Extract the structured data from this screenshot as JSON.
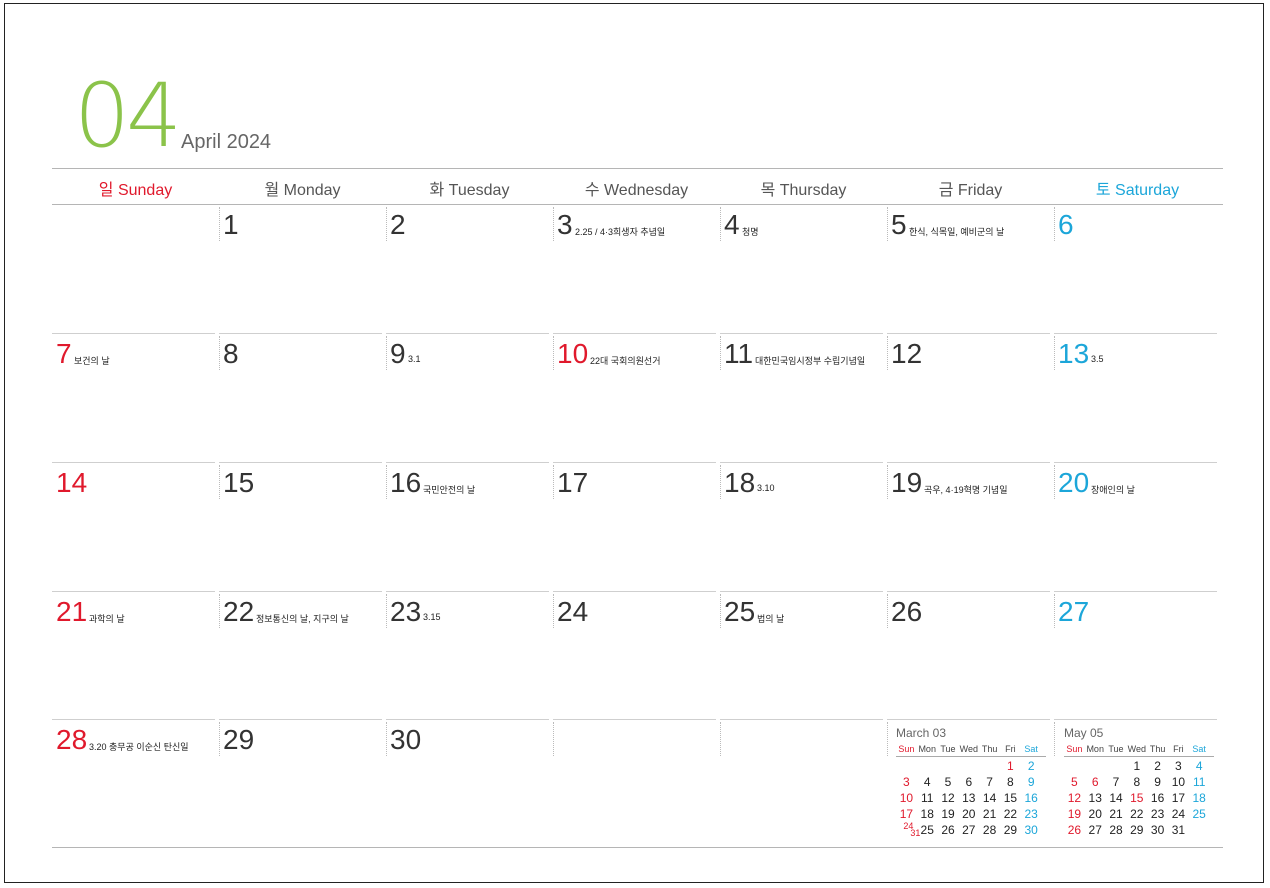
{
  "header": {
    "month_number": "04",
    "month_label": "April 2024"
  },
  "weekdays": [
    {
      "kr": "일",
      "en": "Sunday",
      "type": "sun"
    },
    {
      "kr": "월",
      "en": "Monday",
      "type": ""
    },
    {
      "kr": "화",
      "en": "Tuesday",
      "type": ""
    },
    {
      "kr": "수",
      "en": "Wednesday",
      "type": ""
    },
    {
      "kr": "목",
      "en": "Thursday",
      "type": ""
    },
    {
      "kr": "금",
      "en": "Friday",
      "type": ""
    },
    {
      "kr": "토",
      "en": "Saturday",
      "type": "sat"
    }
  ],
  "weeks": [
    [
      {
        "d": "",
        "n": ""
      },
      {
        "d": "1",
        "n": ""
      },
      {
        "d": "2",
        "n": ""
      },
      {
        "d": "3",
        "n": "2.25 / 4·3희생자 추념일"
      },
      {
        "d": "4",
        "n": "청명"
      },
      {
        "d": "5",
        "n": "한식, 식목일, 예비군의 날"
      },
      {
        "d": "6",
        "n": ""
      }
    ],
    [
      {
        "d": "7",
        "n": "보건의 날"
      },
      {
        "d": "8",
        "n": ""
      },
      {
        "d": "9",
        "n": "3.1"
      },
      {
        "d": "10",
        "n": "22대 국회의원선거",
        "red": true
      },
      {
        "d": "11",
        "n": "대한민국임시정부 수립기념일"
      },
      {
        "d": "12",
        "n": ""
      },
      {
        "d": "13",
        "n": "3.5"
      }
    ],
    [
      {
        "d": "14",
        "n": ""
      },
      {
        "d": "15",
        "n": ""
      },
      {
        "d": "16",
        "n": "국민안전의 날"
      },
      {
        "d": "17",
        "n": ""
      },
      {
        "d": "18",
        "n": "3.10"
      },
      {
        "d": "19",
        "n": "곡우, 4·19혁명 기념일"
      },
      {
        "d": "20",
        "n": "장애인의 날"
      }
    ],
    [
      {
        "d": "21",
        "n": "과학의 날"
      },
      {
        "d": "22",
        "n": "정보통신의 날, 지구의 날"
      },
      {
        "d": "23",
        "n": "3.15"
      },
      {
        "d": "24",
        "n": ""
      },
      {
        "d": "25",
        "n": "법의 날"
      },
      {
        "d": "26",
        "n": ""
      },
      {
        "d": "27",
        "n": ""
      }
    ],
    [
      {
        "d": "28",
        "n": "3.20 충무공 이순신 탄신일"
      },
      {
        "d": "29",
        "n": ""
      },
      {
        "d": "30",
        "n": ""
      },
      {
        "d": "",
        "n": ""
      },
      {
        "d": "",
        "n": ""
      },
      {
        "d": "",
        "n": ""
      },
      {
        "d": "",
        "n": ""
      }
    ]
  ],
  "mini_calendars": [
    {
      "title": "March 03",
      "days_header": [
        "Sun",
        "Mon",
        "Tue",
        "Wed",
        "Thu",
        "Fri",
        "Sat"
      ],
      "rows": [
        [
          "",
          "",
          "",
          "",
          "",
          "1",
          "2"
        ],
        [
          "3",
          "4",
          "5",
          "6",
          "7",
          "8",
          "9"
        ],
        [
          "10",
          "11",
          "12",
          "13",
          "14",
          "15",
          "16"
        ],
        [
          "17",
          "18",
          "19",
          "20",
          "21",
          "22",
          "23"
        ],
        [
          "24/31",
          "25",
          "26",
          "27",
          "28",
          "29",
          "30"
        ]
      ],
      "red_extra": [
        "1"
      ]
    },
    {
      "title": "May 05",
      "days_header": [
        "Sun",
        "Mon",
        "Tue",
        "Wed",
        "Thu",
        "Fri",
        "Sat"
      ],
      "rows": [
        [
          "",
          "",
          "",
          "1",
          "2",
          "3",
          "4"
        ],
        [
          "5",
          "6",
          "7",
          "8",
          "9",
          "10",
          "11"
        ],
        [
          "12",
          "13",
          "14",
          "15",
          "16",
          "17",
          "18"
        ],
        [
          "19",
          "20",
          "21",
          "22",
          "23",
          "24",
          "25"
        ],
        [
          "26",
          "27",
          "28",
          "29",
          "30",
          "31",
          ""
        ]
      ],
      "red_extra": [
        "6",
        "15"
      ]
    }
  ],
  "colors": {
    "accent_green": "#8bc34a",
    "sunday_red": "#e0192c",
    "saturday_blue": "#1ca6d9"
  }
}
